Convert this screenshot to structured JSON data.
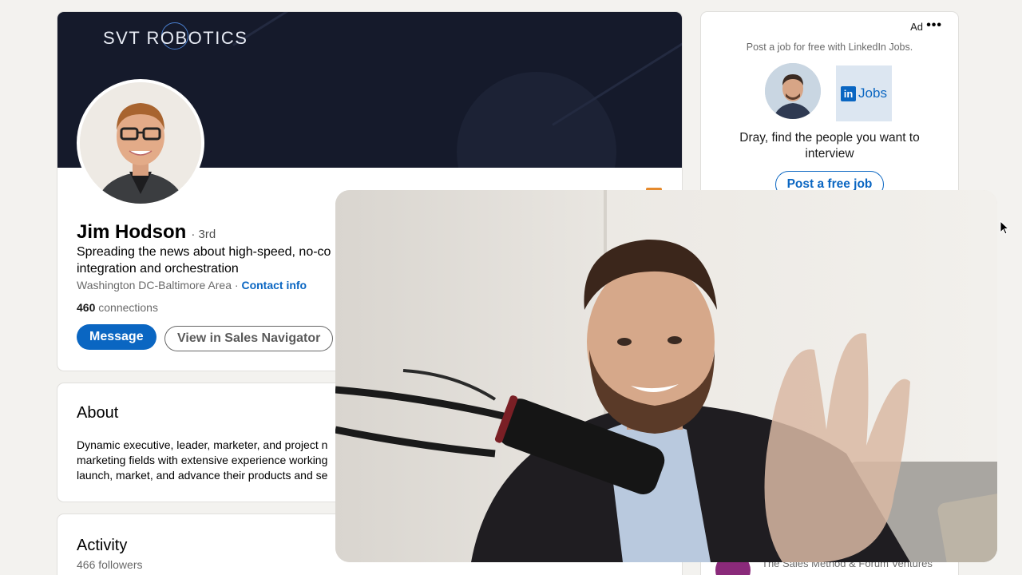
{
  "profile": {
    "banner_company": "SVT ROBOTICS",
    "name": "Jim Hodson",
    "degree": "· 3rd",
    "headline": "Spreading the news about high-speed, no-co integration and orchestration",
    "location": "Washington DC-Baltimore Area · ",
    "contact_info": "Contact info",
    "connections_count": "460",
    "connections_label": " connections",
    "message_label": "Message",
    "sales_navigator_label": "View in Sales Navigator"
  },
  "about": {
    "title": "About",
    "lines": [
      "Dynamic executive, leader, marketer, and project n",
      "marketing fields with extensive experience working",
      "launch, market, and advance their products and se"
    ]
  },
  "activity": {
    "title": "Activity",
    "followers": "466 followers"
  },
  "ad": {
    "label": "Ad",
    "more": "•••",
    "tagline": "Post a job for free with LinkedIn Jobs.",
    "logo_in": "in",
    "logo_jobs": "Jobs",
    "headline": "Dray, find the people you want to interview",
    "cta": "Post a free job"
  },
  "peek": {
    "text": "The Sales Method & Forum Ventures"
  },
  "colors": {
    "linkedin_blue": "#0a66c2",
    "banner_navy": "#151a2b",
    "page_bg": "#f3f2ef"
  }
}
